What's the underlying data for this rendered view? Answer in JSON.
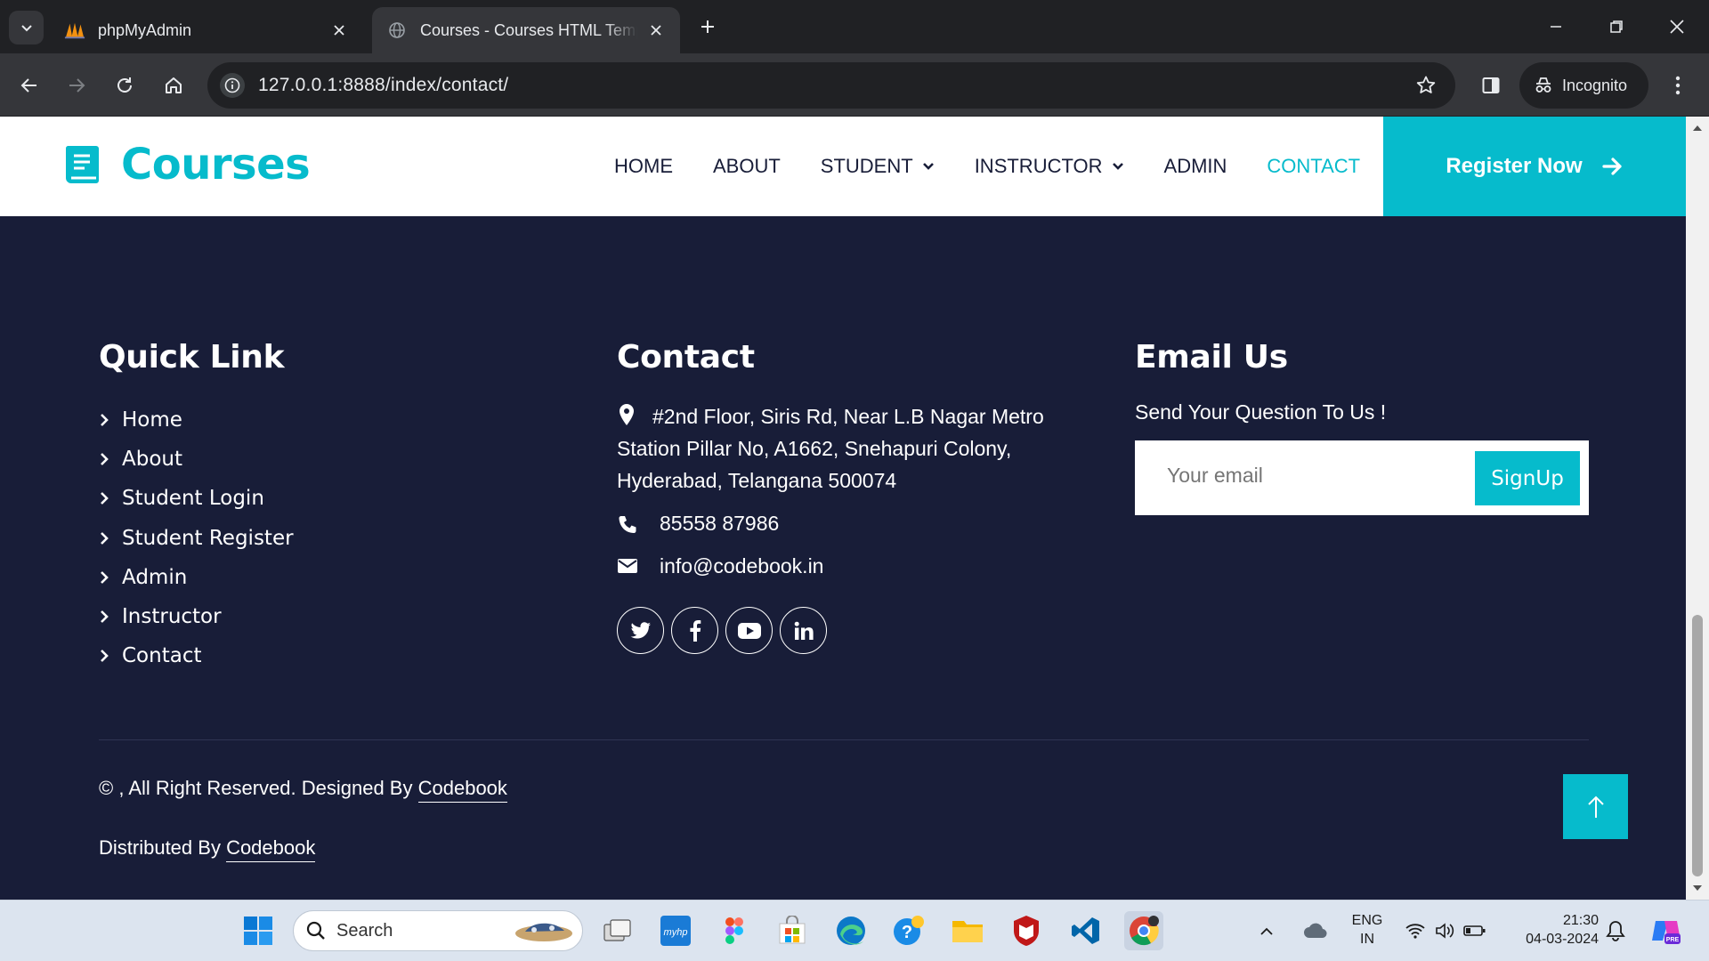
{
  "browser": {
    "tabs": [
      {
        "title": "phpMyAdmin",
        "active": false
      },
      {
        "title": "Courses - Courses HTML Template",
        "active": true
      }
    ],
    "url": "127.0.0.1:8888/index/contact/",
    "incognito_label": "Incognito"
  },
  "site": {
    "brand": "Courses",
    "nav": [
      {
        "label": "HOME",
        "dropdown": false,
        "active": false
      },
      {
        "label": "ABOUT",
        "dropdown": false,
        "active": false
      },
      {
        "label": "STUDENT",
        "dropdown": true,
        "active": false
      },
      {
        "label": "INSTRUCTOR",
        "dropdown": true,
        "active": false
      },
      {
        "label": "ADMIN",
        "dropdown": false,
        "active": false
      },
      {
        "label": "CONTACT",
        "dropdown": false,
        "active": true
      }
    ],
    "register_label": "Register Now",
    "accent_color": "#06bbcc",
    "dark_color": "#181d38"
  },
  "footer": {
    "quick_link": {
      "heading": "Quick Link",
      "items": [
        "Home",
        "About",
        "Student Login",
        "Student Register",
        "Admin",
        "Instructor",
        "Contact"
      ]
    },
    "contact": {
      "heading": "Contact",
      "address_lines": [
        "#2nd Floor, Siris Rd, Near L.B Nagar Metro",
        "Station Pillar No, A1662, Snehapuri Colony,",
        "Hyderabad, Telangana 500074"
      ],
      "phone": "85558 87986",
      "email": "info@codebook.in",
      "socials": [
        "twitter-icon",
        "facebook-icon",
        "youtube-icon",
        "linkedin-icon"
      ]
    },
    "email_us": {
      "heading": "Email Us",
      "text": "Send Your Question To Us !",
      "placeholder": "Your email",
      "button": "SignUp"
    },
    "copyright_prefix": "©  , All Right Reserved. Designed By ",
    "copyright_link": "Codebook",
    "distributed_prefix": "Distributed By ",
    "distributed_link": "Codebook"
  },
  "taskbar": {
    "search_label": "Search",
    "lang_line1": "ENG",
    "lang_line2": "IN",
    "time": "21:30",
    "date": "04-03-2024"
  }
}
